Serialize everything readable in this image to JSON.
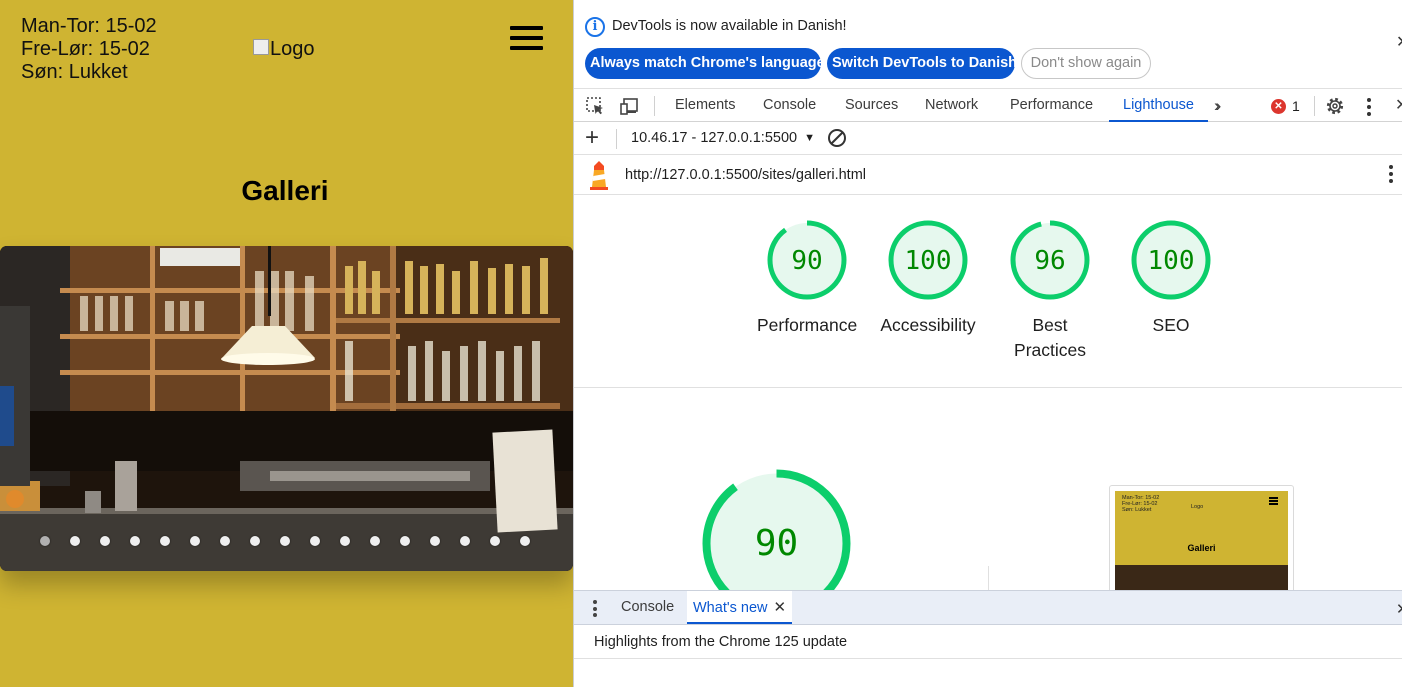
{
  "site": {
    "hours": [
      "Man-Tor: 15-02",
      "Fre-Lør: 15-02",
      "Søn: Lukket"
    ],
    "logo_alt": "Logo",
    "page_title": "Galleri",
    "slide_count": 17,
    "active_slide_index": 0,
    "background_color": "#cfb432"
  },
  "devtools": {
    "infobar": {
      "message": "DevTools is now available in Danish!",
      "buttons": {
        "match": "Always match Chrome's language",
        "switch": "Switch DevTools to Danish",
        "dismiss": "Don't show again"
      }
    },
    "tabs": [
      "Elements",
      "Console",
      "Sources",
      "Network",
      "Performance",
      "Lighthouse"
    ],
    "active_tab": "Lighthouse",
    "error_count": "1",
    "report_selector": "10.46.17 - 127.0.0.1:5500",
    "url": "http://127.0.0.1:5500/sites/galleri.html",
    "scores": [
      {
        "value": "90",
        "label": "Performance"
      },
      {
        "value": "100",
        "label": "Accessibility"
      },
      {
        "value": "96",
        "label": "Best Practices"
      },
      {
        "value": "100",
        "label": "SEO"
      }
    ],
    "main_score": "90",
    "screenshot_thumb": {
      "hours": [
        "Man-Tor: 15-02",
        "Fre-Lør: 15-02",
        "Søn: Lukket"
      ],
      "logo": "Logo",
      "title": "Galleri"
    },
    "drawer": {
      "tabs": [
        "Console",
        "What's new"
      ],
      "active_tab": "What's new",
      "highlight": "Highlights from the Chrome 125 update"
    },
    "colors": {
      "accent": "#0b57d0",
      "score_pass": "#0cce6b",
      "score_pass_fill": "#e6f8ee",
      "score_text": "#008800",
      "error": "#dc362e"
    }
  }
}
